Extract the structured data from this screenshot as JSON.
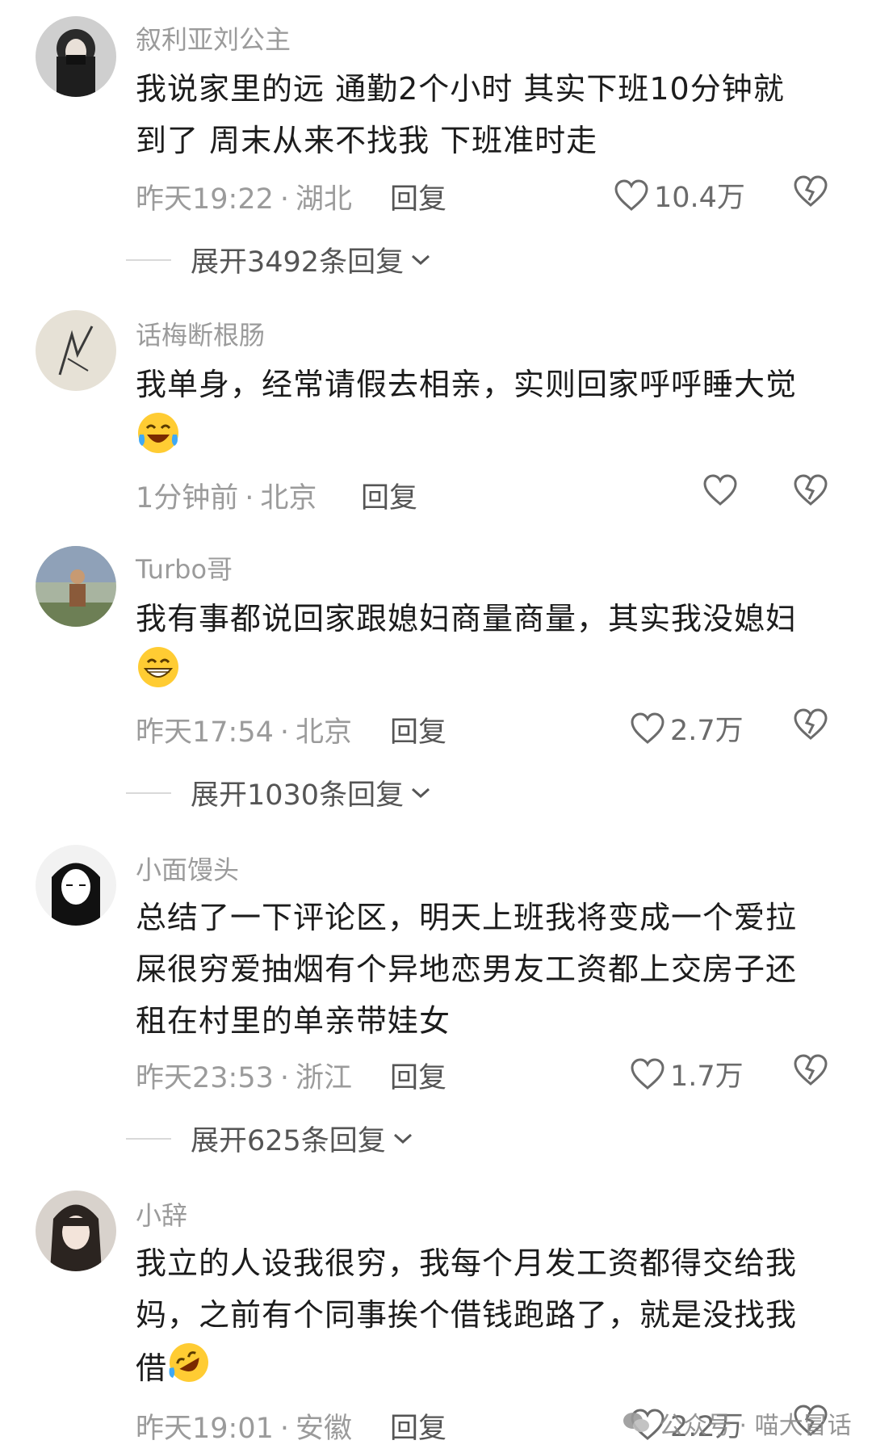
{
  "comments": [
    {
      "username": "叙利亚刘公主",
      "lines": [
        "我说家里的远 通勤2个小时 其实下班10分钟就",
        "到了 周末从来不找我 下班准时走"
      ],
      "time": "昨天19:22",
      "location": "湖北",
      "reply_label": "回复",
      "likes": "10.4万",
      "expand_label": "展开3492条回复"
    },
    {
      "username": "话梅断根肠",
      "lines": [
        "我单身，经常请假去相亲，实则回家呼呼睡大觉"
      ],
      "emoji": "laughing-tears-emoji",
      "time": "1分钟前",
      "location": "北京",
      "reply_label": "回复",
      "likes": ""
    },
    {
      "username": "Turbo哥",
      "lines": [
        "我有事都说回家跟媳妇商量商量，其实我没媳妇"
      ],
      "emoji": "grinning-emoji",
      "time": "昨天17:54",
      "location": "北京",
      "reply_label": "回复",
      "likes": "2.7万",
      "expand_label": "展开1030条回复"
    },
    {
      "username": "小面馒头",
      "lines": [
        "总结了一下评论区，明天上班我将变成一个爱拉",
        "屎很穷爱抽烟有个异地恋男友工资都上交房子还",
        "租在村里的单亲带娃女"
      ],
      "time": "昨天23:53",
      "location": "浙江",
      "reply_label": "回复",
      "likes": "1.7万",
      "expand_label": "展开625条回复"
    },
    {
      "username": "小辞",
      "lines": [
        "我立的人设我很穷，我每个月发工资都得交给我",
        "妈，之前有个同事挨个借钱跑路了，就是没找我",
        "借"
      ],
      "emoji": "rofl-emoji",
      "time": "昨天19:01",
      "location": "安徽",
      "reply_label": "回复",
      "likes": "2.2万"
    }
  ],
  "meta_separator": "·",
  "watermark": "公众号 · 喵大冒话",
  "colors": {
    "meta_gray": "#9b9b9b",
    "body_text": "#1c1c1c",
    "icon_gray": "#8a8a8a"
  }
}
